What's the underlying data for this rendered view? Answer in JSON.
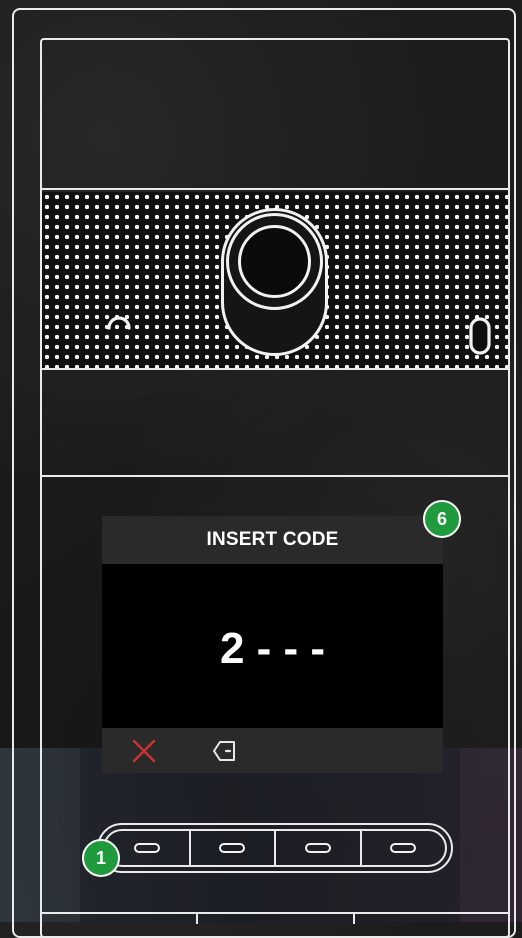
{
  "display": {
    "header": "INSERT CODE",
    "code": "2 - - -",
    "footer_icons": [
      "cancel-icon",
      "backspace-icon"
    ]
  },
  "badges": {
    "display_callout": "6",
    "keypad_callout": "1"
  },
  "keypad": {
    "keys": [
      "key-1",
      "key-2",
      "key-3",
      "key-4"
    ]
  },
  "colors": {
    "badge": "#1f9a3c",
    "cancel": "#d0322d",
    "frame": "#eaeaea"
  }
}
